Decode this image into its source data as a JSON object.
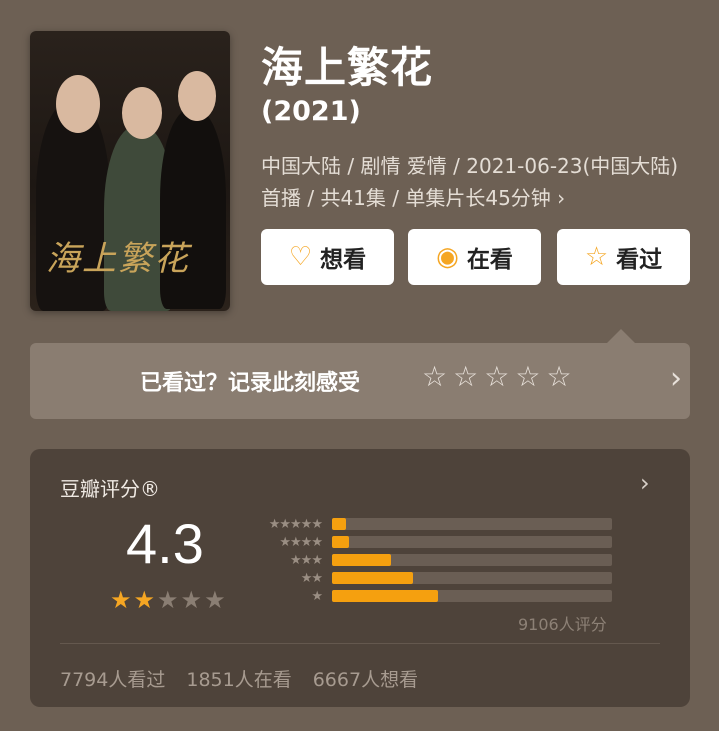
{
  "movie": {
    "title": "海上繁花",
    "year": "(2021)",
    "meta_line": "中国大陆 / 剧情 爱情 / 2021-06-23(中国大陆)首播 / 共41集 / 单集片长45分钟",
    "meta_chevron": "›",
    "poster_title": "海上繁花"
  },
  "actions": {
    "want": {
      "icon": "heart-plus-icon",
      "glyph": "♡",
      "label": "想看"
    },
    "watching": {
      "icon": "target-icon",
      "glyph": "◉",
      "label": "在看"
    },
    "watched": {
      "icon": "star-outline-icon",
      "glyph": "☆",
      "label": "看过"
    }
  },
  "record": {
    "label": "已看过？记录此刻感受",
    "empty_star": "☆",
    "star_count": 5,
    "chevron": "›"
  },
  "rating": {
    "title": "豆瓣评分®",
    "chevron": "›",
    "score": "4.3",
    "score_stars_filled": 2,
    "score_stars_total": 5,
    "filled_star_color": "#f5a623",
    "empty_star_color": "#8a7e73",
    "distribution": [
      {
        "label": "★★★★★",
        "fraction": 0.05
      },
      {
        "label": "★★★★",
        "fraction": 0.06
      },
      {
        "label": "★★★",
        "fraction": 0.21
      },
      {
        "label": "★★",
        "fraction": 0.29
      },
      {
        "label": "★",
        "fraction": 0.38
      }
    ],
    "rating_count": "9106人评分",
    "stats": {
      "watched": "7794人看过",
      "watching": "1851人在看",
      "want": "6667人想看"
    }
  },
  "colors": {
    "background": "#6d6054",
    "accent": "#f5a623",
    "bar_fill": "#f5a00f",
    "card": "#4e433a"
  }
}
